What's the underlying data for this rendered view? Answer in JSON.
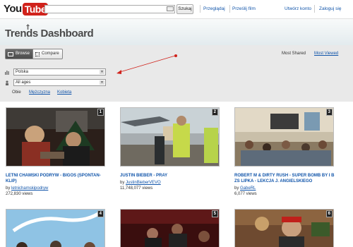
{
  "header": {
    "logo_you": "You",
    "logo_tube": "Tube",
    "search_placeholder": "",
    "search_button": "Szukaj",
    "browse_link": "Przeglądaj",
    "upload_link": "Prześlij film",
    "create_account_link": "Utwórz konto",
    "sign_in_link": "Zaloguj się"
  },
  "page": {
    "title": "Trends Dashboard"
  },
  "view_tabs": {
    "browse": "Browse",
    "compare": "Compare",
    "active": "Browse"
  },
  "sort": {
    "most_shared": "Most Shared",
    "most_viewed": "Most Viewed"
  },
  "filters": {
    "location": "Polska",
    "age": "All ages",
    "gender_options": [
      "Obie",
      "Mężczyzna",
      "Kobieta"
    ],
    "gender_selected": "Obie"
  },
  "videos": [
    {
      "rank": "1",
      "title": "LETNI CHAMSKI PODRYW - BIGOS (SPONTAN-KLIP)",
      "channel": "letnichamskipodryw",
      "views": "272,830 views"
    },
    {
      "rank": "2",
      "title": "JUSTIN BIEBER - PRAY",
      "channel": "JustinBieberVEVO",
      "views": "11,748,077 views"
    },
    {
      "rank": "3",
      "title": "ROBERT M & DIRTY RUSH - SUPER BOMB BY I B ZS LIPKA - LEKCJA J. ANGIELSKIEGO",
      "channel": "GabeRL",
      "views": "6,077 views"
    },
    {
      "rank": "4"
    },
    {
      "rank": "5"
    },
    {
      "rank": "6"
    }
  ],
  "by_prefix": "by",
  "colors": {
    "brand_red": "#d0221b",
    "link_blue": "#1155aa",
    "panel_bg": "#e9e9e9"
  }
}
